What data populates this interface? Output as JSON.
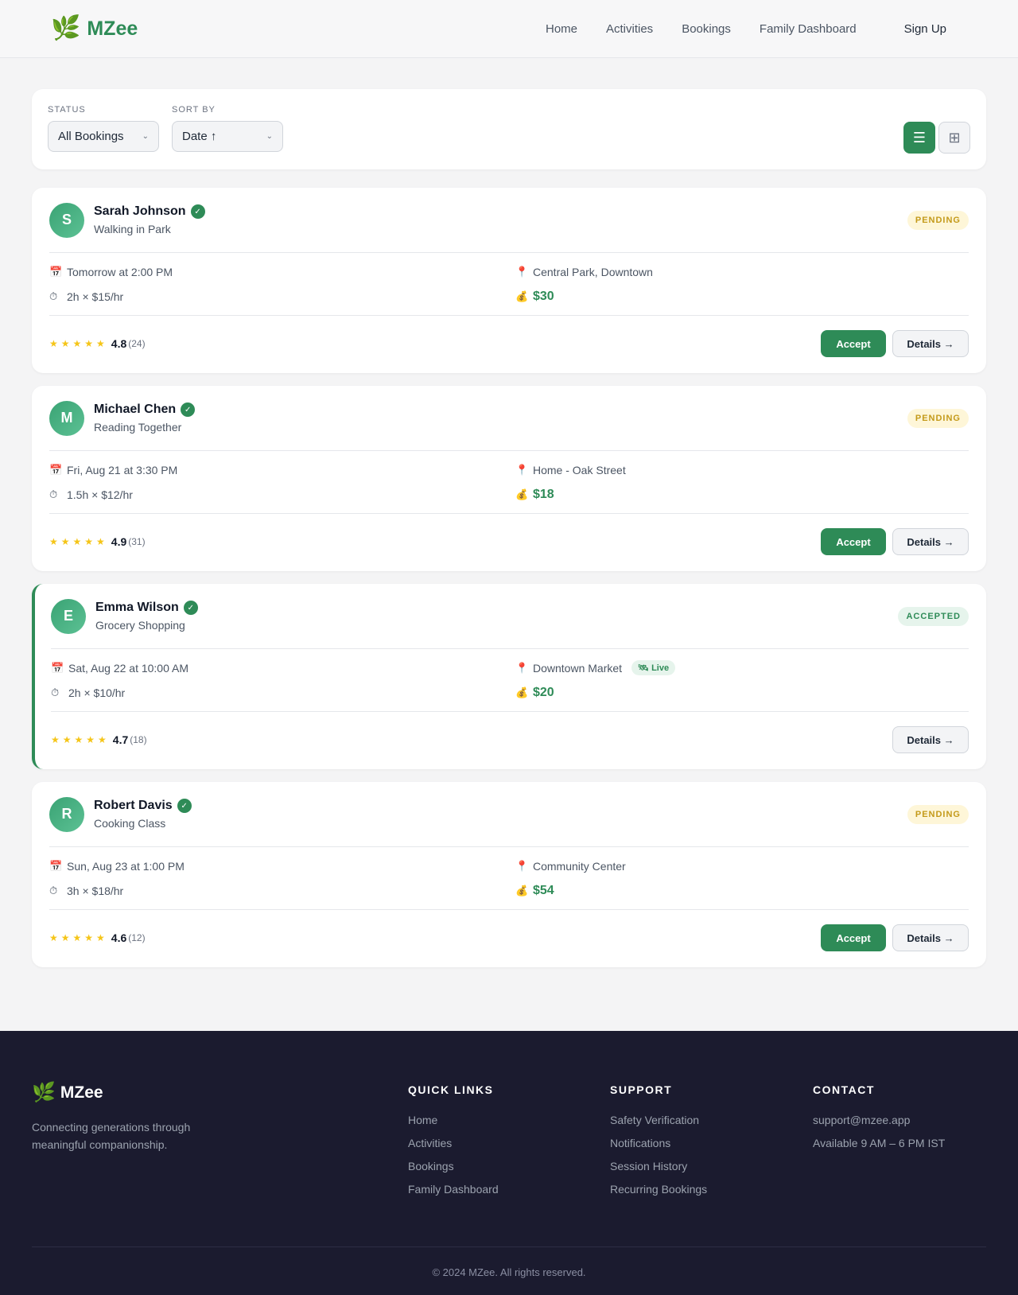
{
  "header": {
    "logo_icon": "🌿",
    "logo_text": "MZee",
    "nav": [
      "Home",
      "Activities",
      "Bookings",
      "Family Dashboard"
    ],
    "signup": "Sign Up"
  },
  "filters": {
    "status_label": "STATUS",
    "status_value": "All Bookings",
    "sort_label": "SORT BY",
    "sort_value": "Date ↑",
    "list_view_icon": "list-icon",
    "grid_view_icon": "grid-icon"
  },
  "bookings": [
    {
      "initial": "S",
      "name": "Sarah Johnson",
      "activity": "Walking in Park",
      "status": "PENDING",
      "date": "Tomorrow at 2:00 PM",
      "location": "Central Park, Downtown",
      "duration": "2h × $15/hr",
      "price": "$30",
      "rating": "4.8",
      "count": "(24)",
      "accept": "Accept",
      "details": "Details →"
    },
    {
      "initial": "M",
      "name": "Michael Chen",
      "activity": "Reading Together",
      "status": "PENDING",
      "date": "Fri, Aug 21 at 3:30 PM",
      "location": "Home - Oak Street",
      "duration": "1.5h × $12/hr",
      "price": "$18",
      "rating": "4.9",
      "count": "(31)",
      "accept": "Accept",
      "details": "Details →"
    },
    {
      "initial": "E",
      "name": "Emma Wilson",
      "activity": "Grocery Shopping",
      "status": "ACCEPTED",
      "date": "Sat, Aug 22 at 10:00 AM",
      "location": "Downtown Market",
      "live": "🛰 Live",
      "duration": "2h × $10/hr",
      "price": "$20",
      "rating": "4.7",
      "count": "(18)",
      "details": "Details →"
    },
    {
      "initial": "R",
      "name": "Robert Davis",
      "activity": "Cooking Class",
      "status": "PENDING",
      "date": "Sun, Aug 23 at 1:00 PM",
      "location": "Community Center",
      "duration": "3h × $18/hr",
      "price": "$54",
      "rating": "4.6",
      "count": "(12)",
      "accept": "Accept",
      "details": "Details →"
    }
  ],
  "icons": {
    "verified": "✓",
    "calendar": "📅",
    "pin": "📍",
    "clock": "⏱",
    "money": "💰",
    "stars": "★★★★★"
  },
  "colors": {
    "brand": "#2e8b57",
    "pending_bg": "#fef6d8",
    "pending_text": "#c49a1a",
    "footer_bg": "#1b1b2f"
  },
  "footer": {
    "logo_icon": "🌿",
    "logo_text": "MZee",
    "tagline": "Connecting generations through meaningful companionship.",
    "quick_links": {
      "title": "QUICK LINKS",
      "items": [
        "Home",
        "Activities",
        "Bookings",
        "Family Dashboard"
      ]
    },
    "support": {
      "title": "SUPPORT",
      "items": [
        "Safety Verification",
        "Notifications",
        "Session History",
        "Recurring Bookings"
      ]
    },
    "contact": {
      "title": "CONTACT",
      "items": [
        "support@mzee.app",
        "Available 9 AM – 6 PM IST"
      ]
    },
    "copyright": "© 2024 MZee. All rights reserved."
  }
}
